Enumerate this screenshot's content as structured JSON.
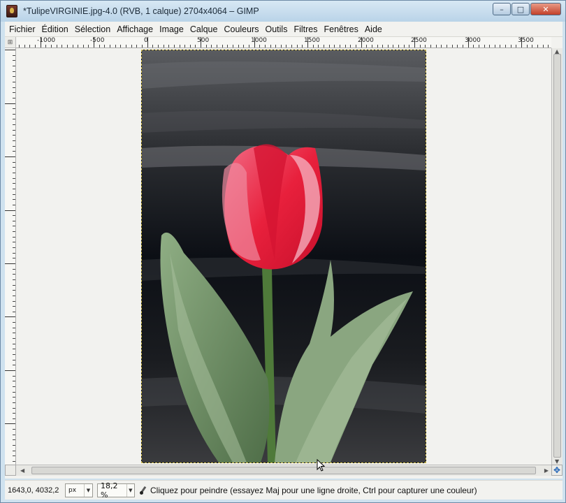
{
  "window": {
    "title": "*TulipeVIRGINIE.jpg-4.0 (RVB, 1 calque) 2704x4064 – GIMP",
    "controls": {
      "minimize": "–",
      "maximize": "□",
      "close": "✕"
    }
  },
  "menubar": {
    "items": [
      {
        "label": "Fichier"
      },
      {
        "label": "Édition"
      },
      {
        "label": "Sélection"
      },
      {
        "label": "Affichage"
      },
      {
        "label": "Image"
      },
      {
        "label": "Calque"
      },
      {
        "label": "Couleurs"
      },
      {
        "label": "Outils"
      },
      {
        "label": "Filtres"
      },
      {
        "label": "Fenêtres"
      },
      {
        "label": "Aide"
      }
    ]
  },
  "rulers": {
    "horizontal_labels": [
      "-1000",
      "-500",
      "0",
      "500",
      "1000",
      "1500",
      "2000",
      "2500",
      "3000",
      "3500"
    ],
    "corner_icon": "⊞"
  },
  "canvas": {
    "image_name": "TulipeVIRGINIE.jpg",
    "colors": {
      "background": "#111317",
      "petal_red": "#e8203c",
      "petal_pink": "#f08aa0",
      "stem_green": "#4f7a3a",
      "leaf_green": "#7e9c74",
      "leaf_light": "#a8c09c"
    }
  },
  "statusbar": {
    "coords": "1643,0, 4032,2",
    "unit": "px",
    "zoom": "18,2 %",
    "tool_icon": "paintbrush-icon",
    "message": "Cliquez pour peindre (essayez Maj pour une ligne droite, Ctrl pour capturer une couleur)"
  },
  "icons": {
    "navigate": "navigate-icon",
    "quick_mask": "quick-mask-icon"
  }
}
